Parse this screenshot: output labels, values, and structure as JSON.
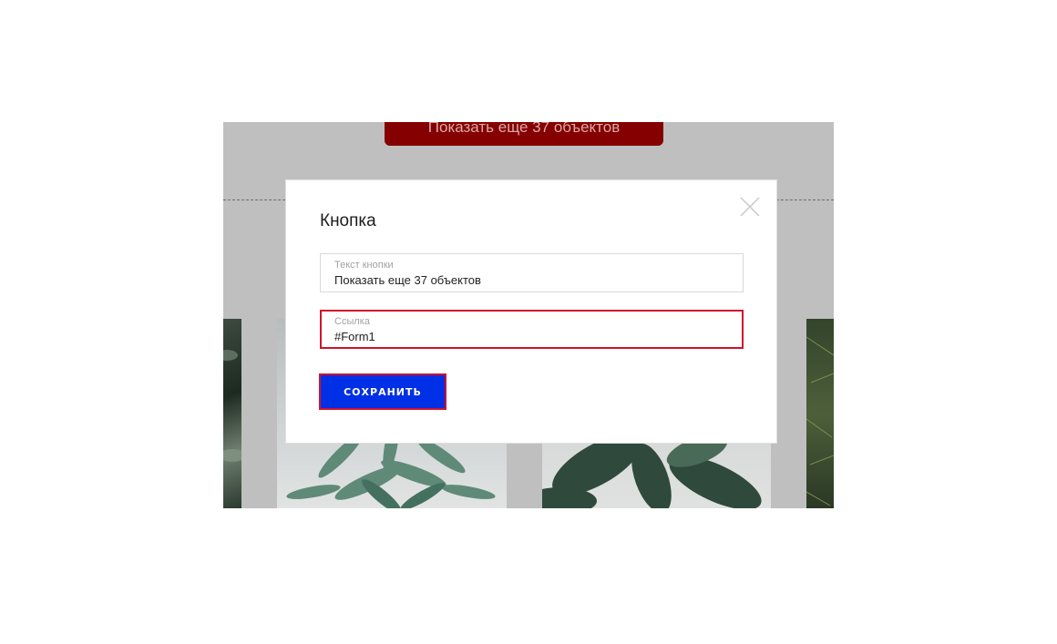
{
  "background": {
    "show_more_button": "Показать еще 37 объектов"
  },
  "modal": {
    "title": "Кнопка",
    "close_icon": "close-icon",
    "fields": [
      {
        "label": "Текст кнопки",
        "value": "Показать еще 37 объектов"
      },
      {
        "label": "Ссылка",
        "value": "#Form1"
      }
    ],
    "save_label": "СОХРАНИТЬ"
  },
  "colors": {
    "accent_blue": "#0030e6",
    "error_red": "#d0112b",
    "brand_dark_red": "#850000"
  }
}
